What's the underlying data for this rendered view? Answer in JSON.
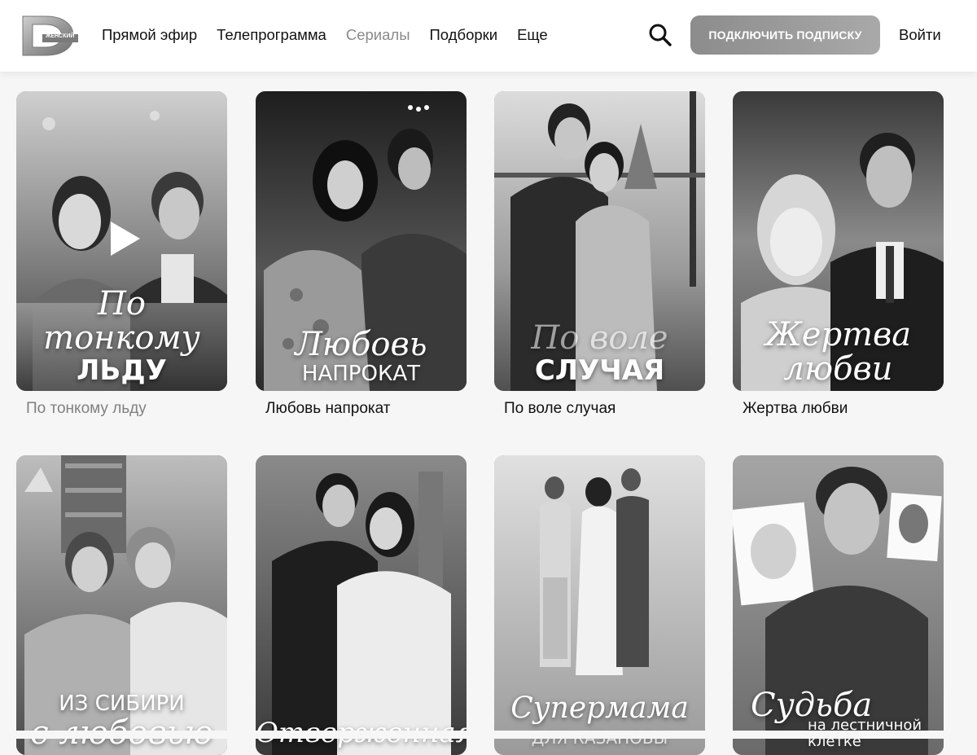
{
  "header": {
    "logo_text": "ЖЕНСКИЙ",
    "nav": [
      {
        "label": "Прямой эфир",
        "active": false
      },
      {
        "label": "Телепрограмма",
        "active": false
      },
      {
        "label": "Сериалы",
        "active": true
      },
      {
        "label": "Подборки",
        "active": false
      },
      {
        "label": "Еще",
        "active": false
      }
    ],
    "subscribe_label": "ПОДКЛЮЧИТЬ ПОДПИСКУ",
    "login_label": "Войти",
    "search_icon": "search-icon"
  },
  "cards": [
    {
      "caption": "По тонкому льду",
      "poster_line1": "По тонкому",
      "poster_line2": "ЛЬДУ",
      "play_icon": "play-icon"
    },
    {
      "caption": "Любовь напрокат",
      "poster_line1": "Любовь",
      "poster_line2": "НАПРОКАТ"
    },
    {
      "caption": "По воле случая",
      "poster_line1": "По воле",
      "poster_line2": "СЛУЧАЯ"
    },
    {
      "caption": "Жертва любви",
      "poster_line1": "Жертва",
      "poster_line2": "любви"
    },
    {
      "caption": "",
      "poster_line1": "ИЗ СИБИРИ",
      "poster_line2": "с любовью"
    },
    {
      "caption": "",
      "poster_line1": "Отверженная",
      "poster_line2": ""
    },
    {
      "caption": "",
      "poster_line1": "Супермама",
      "poster_line2": "ДЛЯ КАЗАНОВЫ"
    },
    {
      "caption": "",
      "poster_line1": "Судьба",
      "poster_line2": "на лестничной клетке"
    }
  ],
  "colors": {
    "accent_button": "#9a9a9a",
    "active_nav": "#8a8a8a",
    "background": "#f6f6f6"
  }
}
